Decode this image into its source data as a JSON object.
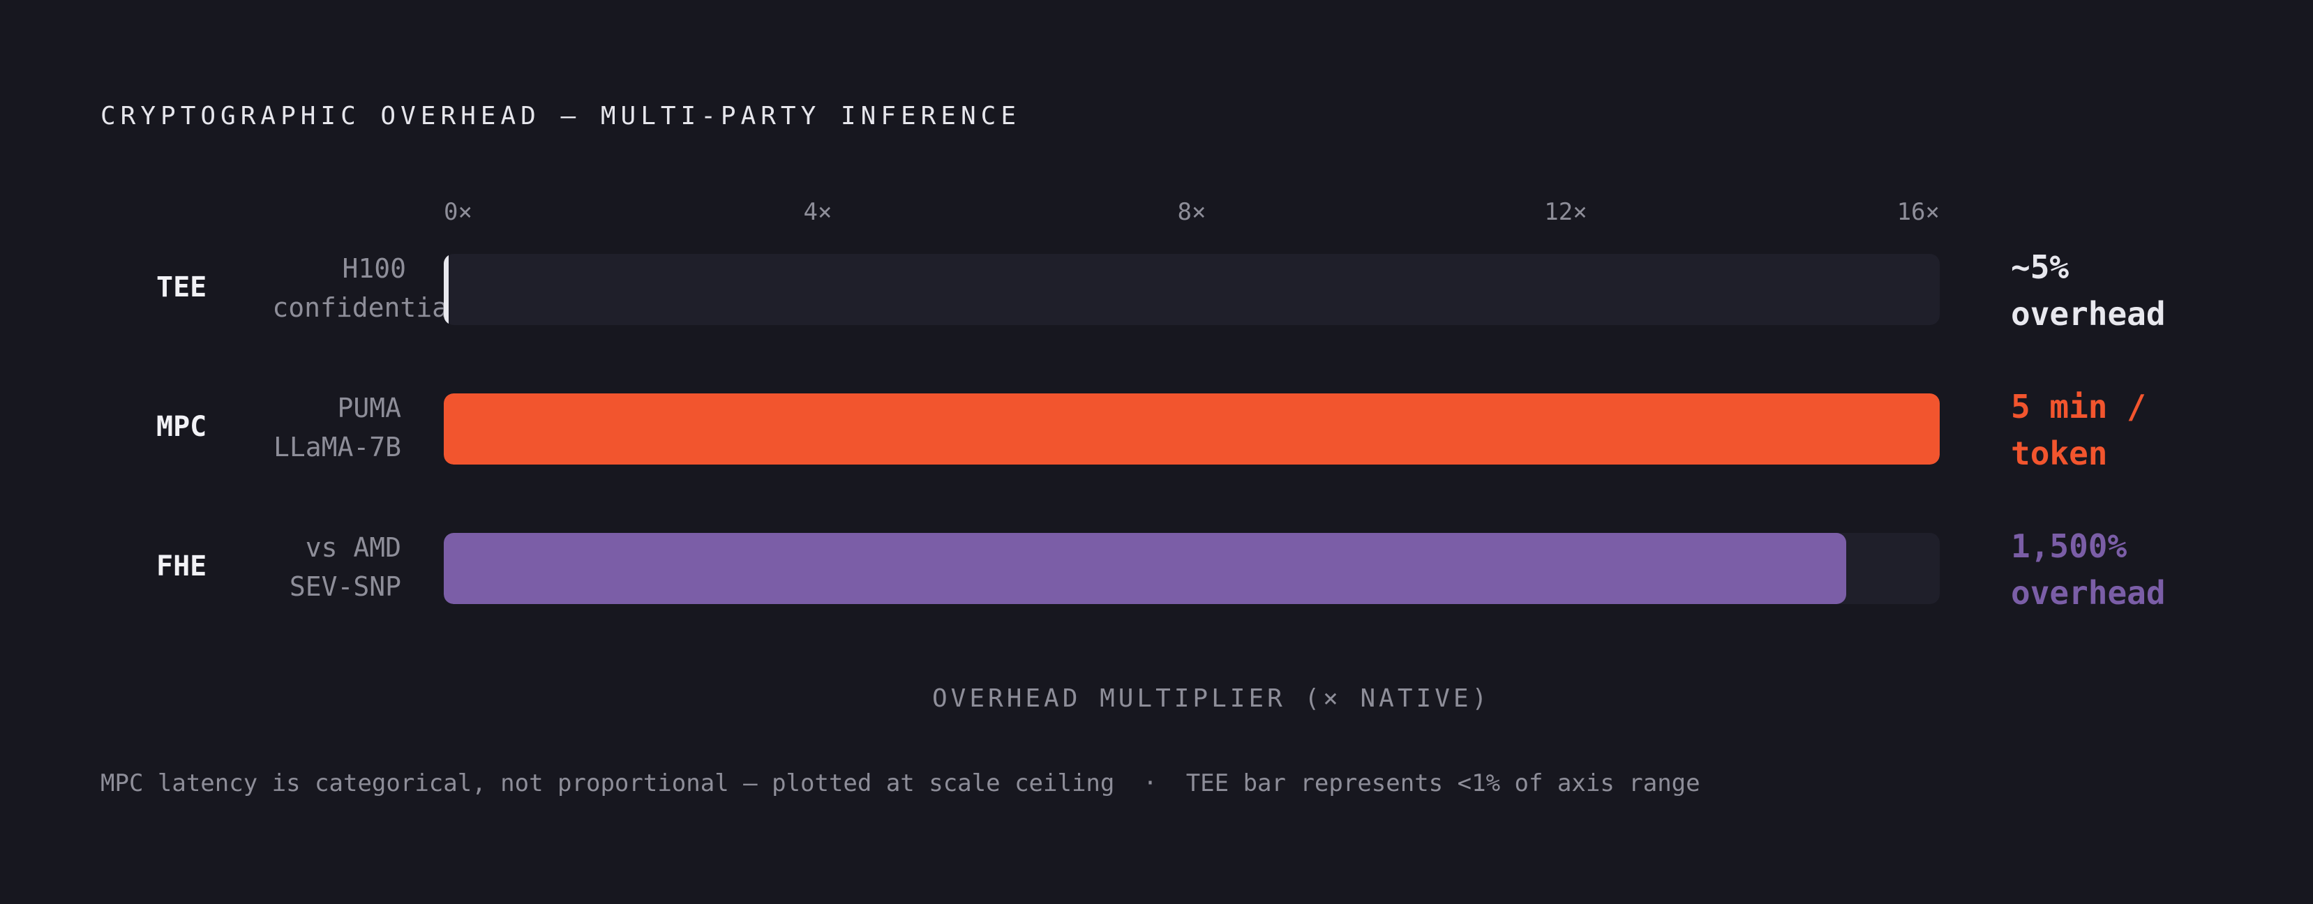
{
  "chart_data": {
    "type": "bar",
    "orientation": "horizontal",
    "title": "CRYPTOGRAPHIC OVERHEAD — MULTI-PARTY INFERENCE",
    "xlabel": "OVERHEAD MULTIPLIER (× NATIVE)",
    "xlim": [
      0,
      16
    ],
    "x_ticks": [
      "0×",
      "4×",
      "8×",
      "12×",
      "16×"
    ],
    "categories": [
      {
        "label": "TEE",
        "sub_line1": "H100",
        "sub_line2": "confidentia",
        "value": 0.05,
        "annotation_line1": "~5%",
        "annotation_line2": "overhead",
        "color": "#e8e8ee"
      },
      {
        "label": "MPC",
        "sub_line1": "PUMA",
        "sub_line2": "LLaMA-7B",
        "value": 16,
        "annotation_line1": "5 min /",
        "annotation_line2": "token",
        "color": "#f2552e"
      },
      {
        "label": "FHE",
        "sub_line1": "vs AMD",
        "sub_line2": "SEV-SNP",
        "value": 15,
        "annotation_line1": "1,500%",
        "annotation_line2": "overhead",
        "color": "#7b5ea7"
      }
    ],
    "footnote": "MPC latency is categorical, not proportional — plotted at scale ceiling  ·  TEE bar represents <1% of axis range",
    "grid": false,
    "legend": "none"
  }
}
